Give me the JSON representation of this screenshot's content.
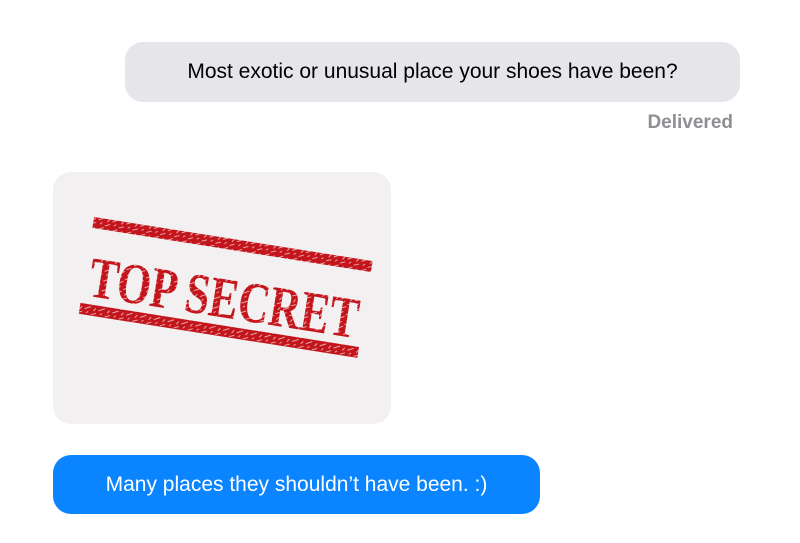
{
  "conversation": {
    "messages": [
      {
        "type": "text",
        "text": "Most exotic or unusual place your shoes have been?"
      },
      {
        "type": "image",
        "stamp_text": "TOP SECRET"
      },
      {
        "type": "text",
        "text": "Many places they shouldn’t have been. :)"
      }
    ],
    "status": "Delivered"
  },
  "colors": {
    "gray_bubble": "#e5e5ea",
    "blue_bubble": "#0a84ff",
    "stamp_red": "#c4151c",
    "status_gray": "#8e8e93"
  }
}
